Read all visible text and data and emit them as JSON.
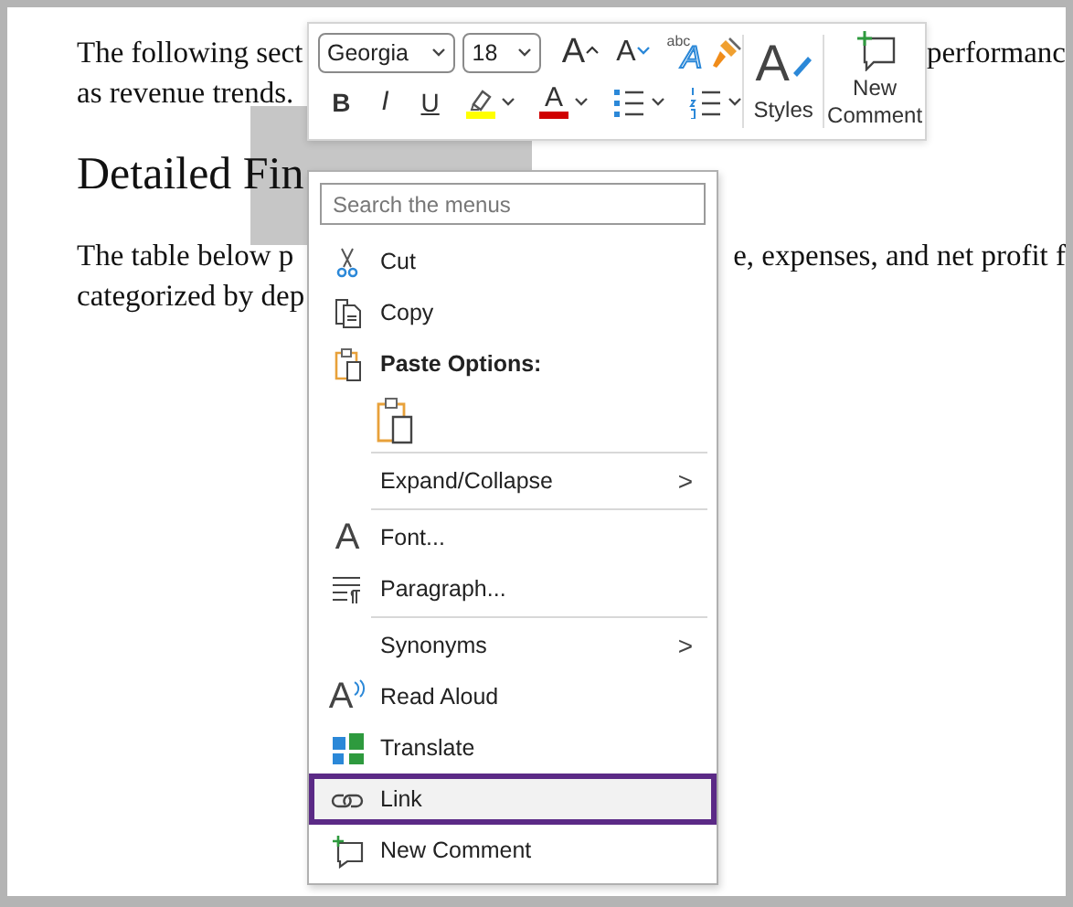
{
  "document": {
    "lines": [
      {
        "kind": "para",
        "parts": [
          "The following sect",
          "performanc"
        ]
      },
      {
        "kind": "para",
        "parts": [
          "as revenue trends."
        ]
      },
      {
        "kind": "heading",
        "parts": [
          "Detailed Fin"
        ]
      },
      {
        "kind": "para",
        "parts": [
          "The table below p",
          "e, expenses, and net profit f"
        ]
      },
      {
        "kind": "para",
        "parts": [
          "categorized by dep"
        ]
      }
    ]
  },
  "toolbar": {
    "font_name": "Georgia",
    "font_size": "18",
    "grow_glyph": "A",
    "shrink_glyph": "A",
    "effects_small": "abc",
    "effects_glyph": "A",
    "bold": "B",
    "italic": "I",
    "underline": "U",
    "font_color_glyph": "A",
    "styles_glyph": "A",
    "styles_label": "Styles",
    "comment_label": "New Comment"
  },
  "context_menu": {
    "search": {
      "placeholder": "Search the menus"
    },
    "groups": [
      [
        {
          "kind": "command",
          "label": "Cut",
          "selected": false
        },
        {
          "kind": "command",
          "label": "Copy",
          "selected": false
        },
        {
          "kind": "header",
          "label": "Paste Options:"
        },
        {
          "kind": "paste"
        }
      ],
      [
        {
          "kind": "submenu",
          "label": "Expand/Collapse",
          "arrow": ">",
          "selected": false
        }
      ],
      [
        {
          "kind": "command",
          "label": "Font...",
          "glyph": "A",
          "selected": false
        },
        {
          "kind": "command",
          "label": "Paragraph...",
          "selected": false
        }
      ],
      [
        {
          "kind": "submenu",
          "label": "Synonyms",
          "arrow": ">",
          "selected": false
        },
        {
          "kind": "command",
          "label": "Read Aloud",
          "glyph": "A",
          "selected": false
        },
        {
          "kind": "command",
          "label": "Translate",
          "selected": false
        },
        {
          "kind": "command",
          "label": "Link",
          "selected": true
        },
        {
          "kind": "command",
          "label": "New Comment",
          "selected": false
        }
      ]
    ]
  }
}
